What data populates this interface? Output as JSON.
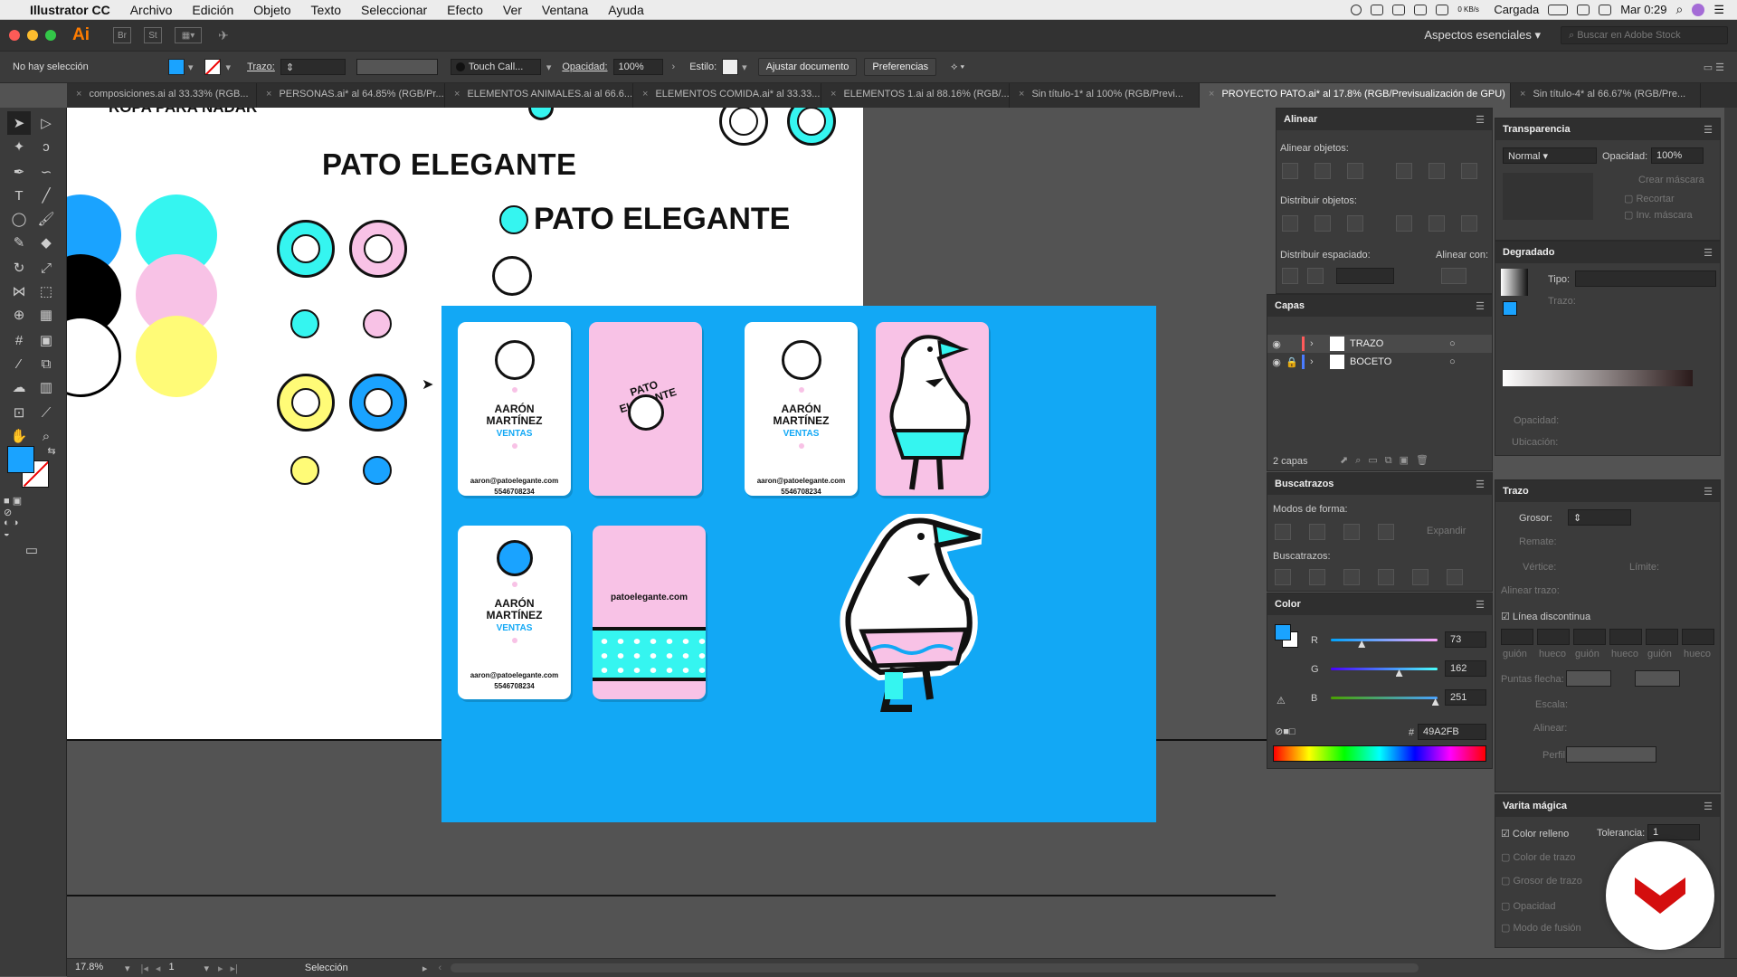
{
  "menubar": {
    "app_name": "Illustrator CC",
    "items": [
      "Archivo",
      "Edición",
      "Objeto",
      "Texto",
      "Seleccionar",
      "Efecto",
      "Ver",
      "Ventana",
      "Ayuda"
    ],
    "status_cargada": "Cargada",
    "net_speed": "0 KB/s",
    "clock": "Mar 0:29"
  },
  "appbar": {
    "logo": "Ai",
    "br": "Br",
    "st": "St",
    "workspace": "Aspectos esenciales",
    "stock_placeholder": "Buscar en Adobe Stock"
  },
  "control": {
    "selection": "No hay selección",
    "trazo_label": "Trazo:",
    "brush": "Touch Call...",
    "opacidad_label": "Opacidad:",
    "opacidad_value": "100%",
    "estilo_label": "Estilo:",
    "ajustar_btn": "Ajustar documento",
    "prefs_btn": "Preferencias",
    "fill_color": "#1aa3ff"
  },
  "tabs": [
    "composiciones.ai al 33.33% (RGB...",
    "PERSONAS.ai* al 64.85% (RGB/Pr...",
    "ELEMENTOS ANIMALES.ai al 66.6...",
    "ELEMENTOS COMIDA.ai* al 33.33...",
    "ELEMENTOS 1.ai al 88.16% (RGB/...",
    "Sin título-1* al 100% (RGB/Previ...",
    "PROYECTO PATO.ai* al 17.8% (RGB/Previsualización de GPU)",
    "Sin título-4* al 66.67% (RGB/Pre..."
  ],
  "active_tab": 6,
  "artboard": {
    "top_text": "ROPA PARA NADAR",
    "title1": "PATO ELEGANTE",
    "title2": "PATO ELEGANTE",
    "logo_text": "PATO ELEGANTE",
    "card_name1": "AARÓN",
    "card_name2": "MARTÍNEZ",
    "card_role": "VENTAS",
    "card_email": "aaron@patoelegante.com",
    "card_phone": "5546708234",
    "card_web": "patoelegante.com",
    "palette": [
      "#1aa3ff",
      "#000000",
      "#ffffff",
      "#35f5f0",
      "#f8c2e6",
      "#fffb77"
    ]
  },
  "status": {
    "zoom": "17.8%",
    "page": "1",
    "tool": "Selección"
  },
  "panels": {
    "alinear": {
      "title": "Alinear",
      "alinear_obj": "Alinear objetos:",
      "distribuir_obj": "Distribuir objetos:",
      "distribuir_esp": "Distribuir espaciado:",
      "alinear_con": "Alinear con:"
    },
    "transparencia": {
      "title": "Transparencia",
      "mode": "Normal",
      "opacidad_label": "Opacidad:",
      "opacidad_value": "100%",
      "crear_mascara": "Crear máscara",
      "recortar": "Recortar",
      "inv_mascara": "Inv. máscara"
    },
    "degradado": {
      "title": "Degradado",
      "tipo": "Tipo:",
      "trazo": "Trazo:",
      "opacidad": "Opacidad:",
      "ubicacion": "Ubicación:"
    },
    "capas": {
      "title": "Capas",
      "layers": [
        "TRAZO",
        "BOCETO"
      ],
      "count": "2 capas"
    },
    "buscatrazos": {
      "title": "Buscatrazos",
      "modos": "Modos de forma:",
      "expandir": "Expandir",
      "buscatrazos_label": "Buscatrazos:"
    },
    "color": {
      "title": "Color",
      "r_label": "R",
      "g_label": "G",
      "b_label": "B",
      "r": "73",
      "g": "162",
      "b": "251",
      "hex_prefix": "#",
      "hex": "49A2FB",
      "r_level": 0.29,
      "g_level": 0.64,
      "b_level": 0.98
    },
    "trazo": {
      "title": "Trazo",
      "grosor": "Grosor:",
      "remate": "Remate:",
      "vertice": "Vértice:",
      "limite": "Límite:",
      "alinear_trazo": "Alinear trazo:",
      "linea_discontinua": "Línea discontinua",
      "dash_labels": [
        "guión",
        "hueco",
        "guión",
        "hueco",
        "guión",
        "hueco"
      ],
      "puntas_flecha": "Puntas flecha:",
      "escala": "Escala:",
      "alinear": "Alinear:",
      "perfil": "Perfil:"
    },
    "varita": {
      "title": "Varita mágica",
      "color_relleno": "Color relleno",
      "tolerancia_label": "Tolerancia:",
      "tolerancia": "1",
      "color_trazo": "Color de trazo",
      "grosor_trazo": "Grosor de trazo",
      "opacidad": "Opacidad",
      "modo_fusion": "Modo de fusión"
    }
  }
}
